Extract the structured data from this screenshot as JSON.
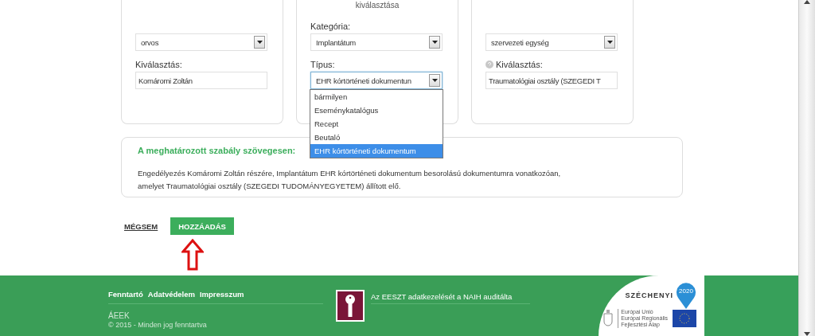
{
  "cards": [
    {
      "fields": [
        {
          "kind": "select",
          "value": "orvos",
          "focused": false
        },
        {
          "kind": "input",
          "label": "Kiválasztás:",
          "value": "Komáromi Zoltán",
          "help": false
        }
      ]
    },
    {
      "title": "kiválasztása",
      "fields": [
        {
          "kind": "select",
          "label": "Kategória:",
          "value": "Implantátum",
          "focused": false
        },
        {
          "kind": "select",
          "label": "Típus:",
          "value": "EHR kórtörténeti dokumentun",
          "focused": true,
          "options": [
            {
              "label": "bármilyen",
              "selected": false
            },
            {
              "label": "Eseménykatalógus",
              "selected": false
            },
            {
              "label": "Recept",
              "selected": false
            },
            {
              "label": "Beutaló",
              "selected": false
            },
            {
              "label": "EHR kórtörténeti dokumentum",
              "selected": true
            }
          ]
        }
      ]
    },
    {
      "fields": [
        {
          "kind": "select",
          "value": "szervezeti egység",
          "focused": false
        },
        {
          "kind": "input",
          "label": "Kiválasztás:",
          "value": "Traumatológiai osztály (SZEGEDI T",
          "help": true
        }
      ]
    }
  ],
  "rule": {
    "title": "A meghatározott szabály szövegesen:",
    "text": "Engedélyezés Komáromi Zoltán részére, Implantátum EHR kórtörténeti dokumentum besorolású dokumentumra vonatkozóan,\namelyet Traumatológiai osztály (SZEGEDI TUDOMÁNYEGYETEM) állított elő."
  },
  "actions": {
    "cancel": "MÉGSEM",
    "submit": "HOZZÁADÁS"
  },
  "footer": {
    "links": [
      "Fenntartó",
      "Adatvédelem",
      "Impresszum"
    ],
    "org": "ÁEEK",
    "copyright": "© 2015 - Minden jog fenntartva",
    "audit": "Az EESZT adatkezelését a NAIH auditálta",
    "logo": {
      "name": "SZÉCHENYI",
      "year": "2020",
      "eu": [
        "Európai Unió",
        "Európai Regionális",
        "Fejlesztési Alap"
      ]
    }
  }
}
